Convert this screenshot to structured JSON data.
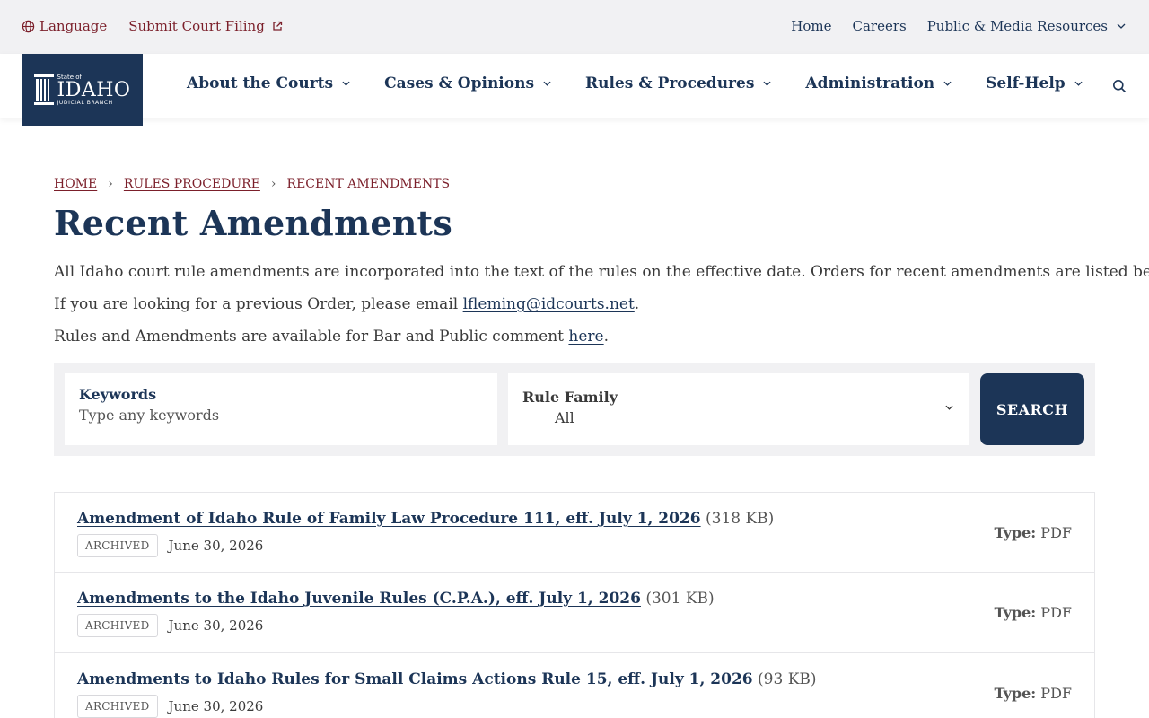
{
  "utility_bar": {
    "language_label": "Language",
    "filing_label": "Submit Court Filing",
    "right_links": [
      "Home",
      "Careers",
      "Public & Media Resources"
    ]
  },
  "logo": {
    "line1": "State of",
    "line2": "IDAHO",
    "line3": "JUDICIAL BRANCH"
  },
  "nav": {
    "items": [
      "About the Courts",
      "Cases & Opinions",
      "Rules & Procedures",
      "Administration",
      "Self-Help"
    ]
  },
  "breadcrumb": {
    "items": [
      "HOME",
      "RULES PROCEDURE",
      "RECENT AMENDMENTS"
    ],
    "separator": "›"
  },
  "page": {
    "title": "Recent Amendments",
    "p1": "All Idaho court rule amendments are incorporated into the text of the rules on the effective date. Orders for recent amendments are listed below.",
    "p2_prefix": "If you are looking for a previous Order, please email ",
    "p2_link": "lfleming@idcourts.net",
    "p2_suffix": ".",
    "p3_prefix": "Rules and Amendments are available for Bar and Public comment ",
    "p3_link": "here",
    "p3_suffix": "."
  },
  "filters": {
    "keywords_label": "Keywords",
    "keywords_placeholder": "Type any keywords",
    "keywords_value": "",
    "rule_family_label": "Rule Family",
    "rule_family_value": "All",
    "search_button": "SEARCH"
  },
  "results": [
    {
      "title": "Amendment of Idaho Rule of Family Law Procedure 111, eff. July 1, 2026",
      "size": "(318 KB)",
      "badge": "ARCHIVED",
      "date": "June 30, 2026",
      "type_label": "Type:",
      "type": "PDF"
    },
    {
      "title": "Amendments to the Idaho Juvenile Rules (C.P.A.), eff. July 1, 2026",
      "size": "(301 KB)",
      "badge": "ARCHIVED",
      "date": "June 30, 2026",
      "type_label": "Type:",
      "type": "PDF"
    },
    {
      "title": "Amendments to Idaho Rules for Small Claims Actions Rule 15, eff. July 1, 2026",
      "size": "(93 KB)",
      "badge": "ARCHIVED",
      "date": "June 30, 2026",
      "type_label": "Type:",
      "type": "PDF"
    }
  ],
  "colors": {
    "navy": "#1c3557",
    "maroon": "#7b1f2a",
    "panel_gray": "#f1f1f3"
  },
  "icons": {
    "language": "globe-icon",
    "external": "external-link-icon",
    "chevron": "chevron-down-icon",
    "search": "search-icon"
  }
}
